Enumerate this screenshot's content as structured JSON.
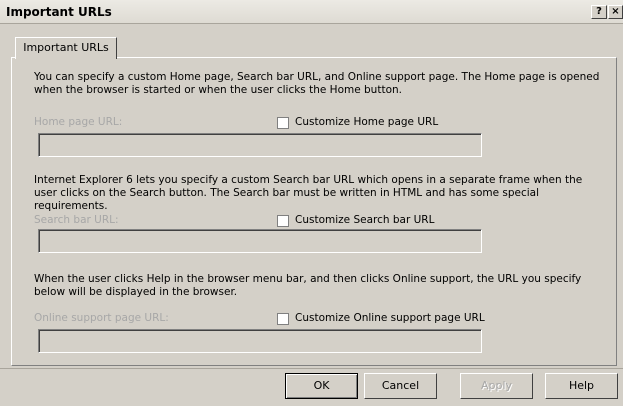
{
  "window": {
    "title": "Important URLs",
    "help_glyph": "?",
    "close_glyph": "×"
  },
  "tab": {
    "label": "Important URLs"
  },
  "sections": {
    "home": {
      "description": "You can specify a custom Home page, Search bar URL, and Online support page. The Home page is opened when the browser is started or when the user clicks the Home button.",
      "field_label": "Home page URL:",
      "checkbox_label": "Customize Home page URL",
      "checked": false,
      "value": ""
    },
    "search": {
      "description": "Internet Explorer 6 lets you specify a custom Search bar URL which opens in a separate frame when the user clicks on the Search button. The Search bar must be written in HTML and has some special requirements.",
      "field_label": "Search bar URL:",
      "checkbox_label": "Customize Search bar URL",
      "checked": false,
      "value": ""
    },
    "support": {
      "description": "When the user clicks Help in the browser menu bar, and then clicks Online support, the URL you specify below will be displayed in the browser.",
      "field_label": "Online support page URL:",
      "checkbox_label": "Customize Online support page URL",
      "checked": false,
      "value": ""
    }
  },
  "buttons": {
    "ok": "OK",
    "cancel": "Cancel",
    "apply": "Apply",
    "help": "Help"
  }
}
